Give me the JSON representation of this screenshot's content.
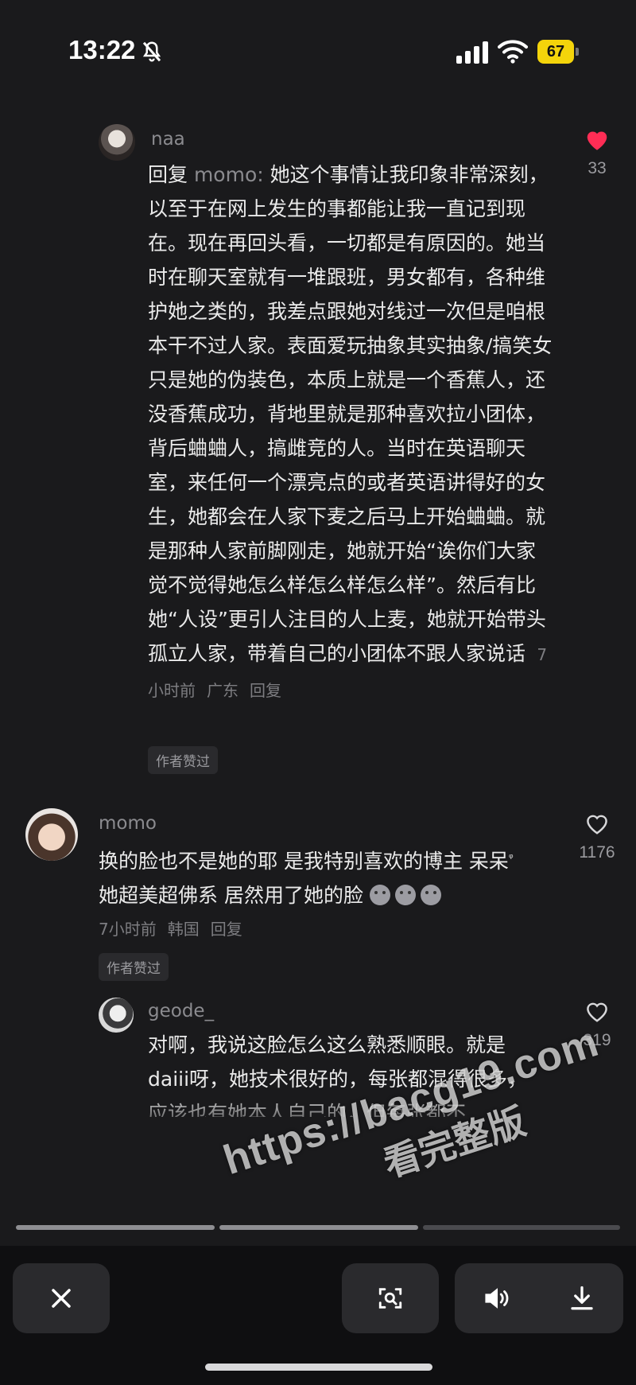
{
  "status_bar": {
    "time": "13:22",
    "battery": "67",
    "icons": [
      "bell-slash-icon",
      "cellular-signal-icon",
      "wifi-icon",
      "battery-icon"
    ]
  },
  "comments": [
    {
      "username": "naa",
      "reply_prefix": "回复 ",
      "reply_target": "momo:",
      "text": " 她这个事情让我印象非常深刻，以至于在网上发生的事都能让我一直记到现在。现在再回头看，一切都是有原因的。她当时在聊天室就有一堆跟班，男女都有，各种维护她之类的，我差点跟她对线过一次但是咱根本干不过人家。表面爱玩抽象其实抽象/搞笑女只是她的伪装色，本质上就是一个香蕉人，还没香蕉成功，背地里就是那种喜欢拉小团体，背后蛐蛐人，搞雌竞的人。当时在英语聊天室，来任何一个漂亮点的或者英语讲得好的女生，她都会在人家下麦之后马上开始蛐蛐。就是那种人家前脚刚走，她就开始“诶你们大家觉不觉得她怎么样怎么样怎么样”。然后有比她“人设”更引人注目的人上麦，她就开始带头孤立人家，带着自己的小团体不跟人家说话",
      "time": "7小时前",
      "location": "广东",
      "reply_label": "回复",
      "badge": "作者赞过",
      "likes": "33",
      "liked": true
    },
    {
      "username": "momo",
      "text_a": "换的脸也不是她的耶 是我特别喜欢的博主 呆呆",
      "search_glyph": "ᵠ",
      "text_b": "她超美超佛系 居然用了她的脸",
      "emoji": [
        "awkward-face-emoji",
        "awkward-face-emoji",
        "awkward-face-emoji"
      ],
      "time": "7小时前",
      "location": "韩国",
      "reply_label": "回复",
      "badge": "作者赞过",
      "likes": "1176",
      "liked": false
    },
    {
      "username": "geode_",
      "text": "对啊，我说这脸怎么这么熟悉顺眼。就是daiii呀，她技术很好的，每张都混得很多，应该也有她本人自己的，但每张都不",
      "likes": "319",
      "liked": false
    }
  ],
  "progress": [
    {
      "filled": true
    },
    {
      "filled": true
    },
    {
      "filled": false
    }
  ],
  "controls": {
    "close": "close-icon",
    "scan": "scan-icon",
    "volume": "volume-icon",
    "download": "download-icon"
  },
  "watermark": {
    "url": "https://bacg19.com",
    "text": "看完整版"
  },
  "colors": {
    "background": "#1a1a1c",
    "like_red": "#ff2d55",
    "battery": "#f4d40b"
  }
}
